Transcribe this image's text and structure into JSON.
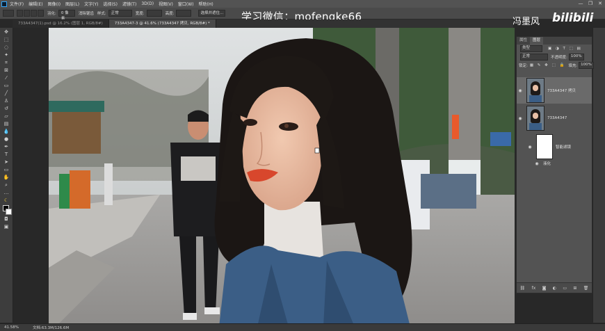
{
  "menu": {
    "items": [
      "文件(F)",
      "编辑(E)",
      "图像(I)",
      "图层(L)",
      "文字(Y)",
      "选择(S)",
      "滤镜(T)",
      "3D(D)",
      "视图(V)",
      "窗口(W)",
      "帮助(H)"
    ],
    "window_controls": [
      "—",
      "❐",
      "✕"
    ]
  },
  "options": {
    "feather_label": "羽化:",
    "feather_value": "0 像素",
    "antialias": "消除锯齿",
    "style_label": "样式:",
    "style_value": "正常",
    "width_label": "宽度:",
    "height_label": "高度:",
    "select_mask": "选择并遮住...",
    "extra_value": "5"
  },
  "tabs": [
    {
      "label": "733A4347(1).psd @ 16.2% (图层 1, RGB/8#)",
      "active": false
    },
    {
      "label": "733A4347-3 @ 41.6% (733A4347 拷贝, RGB/8#) *",
      "active": true
    }
  ],
  "watermark": {
    "text": "学习微信：mofengke66",
    "brand": "冯墨风",
    "logo": "bilibili"
  },
  "layers_panel": {
    "tabs": [
      "属性",
      "图层"
    ],
    "kind_label": "类型",
    "blend_mode": "正常",
    "opacity_label": "不透明度:",
    "opacity_value": "100%",
    "lock_label": "锁定:",
    "fill_label": "填充:",
    "fill_value": "100%",
    "layers": [
      {
        "name": "733A4347 拷贝",
        "selected": true,
        "visible": true
      },
      {
        "name": "733A4347",
        "selected": false,
        "visible": true
      },
      {
        "name": "智能滤镜",
        "selected": false,
        "visible": true
      },
      {
        "name": "液化",
        "selected": false,
        "visible": true
      }
    ],
    "footer_icons": [
      "link-icon",
      "fx-icon",
      "mask-icon",
      "adjustment-icon",
      "folder-icon",
      "new-layer-icon",
      "trash-icon"
    ]
  },
  "status": {
    "zoom": "41.58%",
    "doc": "文档:63.3M/126.6M"
  }
}
